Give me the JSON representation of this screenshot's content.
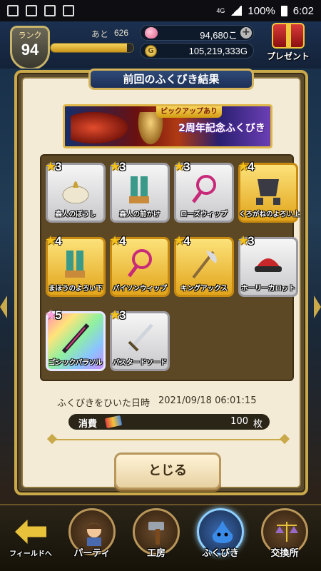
{
  "status_bar": {
    "network": "4G",
    "battery": "100%",
    "time": "6:02"
  },
  "hud": {
    "rank_label": "ランク",
    "rank_value": "94",
    "exp_label": "あと",
    "exp_value": "626",
    "exp_fill_fraction": 0.92,
    "gems_value": "94,680こ",
    "gold_value": "105,219,333G",
    "gold_icon_glyph": "G",
    "plus_label": "+",
    "present_label": "プレゼント"
  },
  "dialog": {
    "title": "前回のふくびき結果",
    "banner_tag": "ピックアップあり",
    "banner_title": "2周年記念ふくびき",
    "items": [
      {
        "stars": "3",
        "rarity": "r3",
        "name": "森人のぼうし",
        "icon": "hat-icon"
      },
      {
        "stars": "3",
        "rarity": "r3",
        "name": "森人の前かけ",
        "icon": "leg-armor-icon"
      },
      {
        "stars": "3",
        "rarity": "r3",
        "name": "ローズウィップ",
        "icon": "whip-icon"
      },
      {
        "stars": "4",
        "rarity": "r4",
        "name": "くろがねのよろい上",
        "icon": "chest-armor-icon"
      },
      {
        "stars": "4",
        "rarity": "r4",
        "name": "まほうのよろい下",
        "icon": "leg-armor-icon"
      },
      {
        "stars": "4",
        "rarity": "r4",
        "name": "パイソンウィップ",
        "icon": "whip-icon"
      },
      {
        "stars": "4",
        "rarity": "r4",
        "name": "キングアックス",
        "icon": "axe-icon"
      },
      {
        "stars": "3",
        "rarity": "r3",
        "name": "ホーリーカロット",
        "icon": "cap-icon"
      },
      {
        "stars": "5",
        "rarity": "r5",
        "name": "ゴシックパラソル",
        "icon": "parasol-icon"
      },
      {
        "stars": "3",
        "rarity": "r3",
        "name": "バスタードソード",
        "icon": "sword-icon"
      }
    ],
    "date_label": "ふくびきをひいた日時",
    "date_value": "2021/09/18 06:01:15",
    "cost_label": "消費",
    "cost_value": "100",
    "cost_unit": "枚",
    "close_label": "とじる"
  },
  "nav": {
    "field_label": "フィールドへ",
    "items": [
      "パーティ",
      "工房",
      "ふくびき",
      "交換所"
    ],
    "active": "ふくびき"
  },
  "colors": {
    "star_gold": "#f4c21a",
    "rarity3": "#c9c9cc",
    "rarity4": "#e2a51c",
    "dialog_bg": "#f3ebd6",
    "accent_blue": "#2f4a78"
  }
}
